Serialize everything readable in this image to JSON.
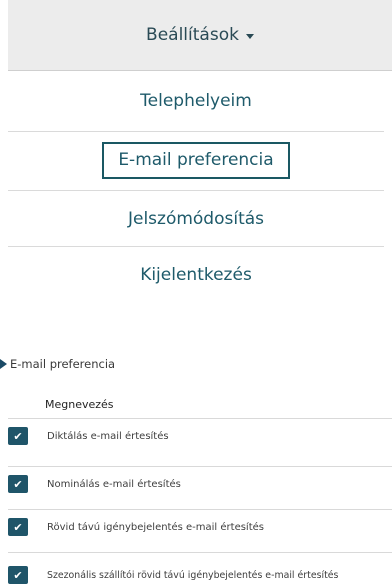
{
  "header": {
    "label": "Beállítások"
  },
  "menu": {
    "items": [
      {
        "label": "Telephelyeim"
      },
      {
        "label": "E-mail preferencia"
      },
      {
        "label": "Jelszómódosítás"
      },
      {
        "label": "Kijelentkezés"
      }
    ]
  },
  "section": {
    "title": "E-mail preferencia"
  },
  "table": {
    "header": "Megnevezés",
    "rows": [
      {
        "label": "Diktálás e-mail értesítés",
        "checked": true
      },
      {
        "label": "Nominálás e-mail értesítés",
        "checked": true
      },
      {
        "label": "Rövid távú igénybejelentés e-mail értesítés",
        "checked": true
      },
      {
        "label": "Szezonális szállítói rövid távú igénybejelentés e-mail értesítés",
        "checked": true
      }
    ]
  },
  "icons": {
    "check": "check-icon",
    "caret": "caret-down-icon",
    "toggle": "triangle-right-icon"
  },
  "colors": {
    "accent": "#1f5569",
    "header_bg": "#ececec",
    "menu_text": "#1e5a6a"
  }
}
